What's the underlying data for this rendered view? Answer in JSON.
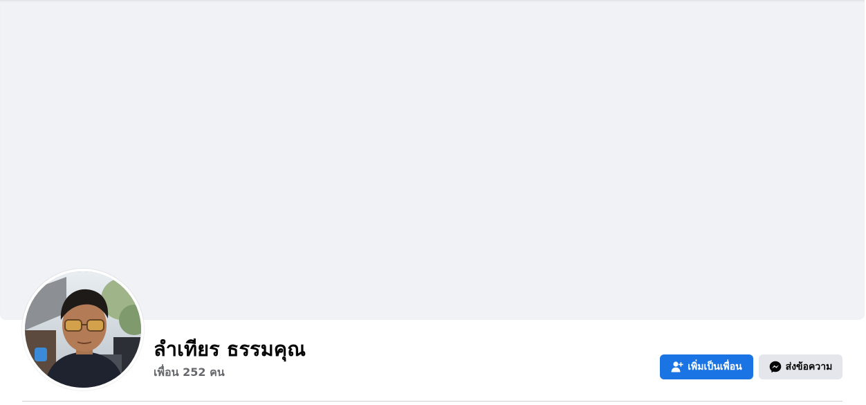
{
  "profile": {
    "name": "ลำเทียร ธรรมคุณ",
    "friends_count": "เพื่อน 252 คน"
  },
  "actions": {
    "add_friend_label": "เพิ่มเป็นเพื่อน",
    "add_friend_icon": "person-add-icon",
    "message_label": "ส่งข้อความ",
    "message_icon": "messenger-icon"
  },
  "colors": {
    "cover_background": "#f0f2f5",
    "primary_button": "#1b74e4",
    "secondary_button": "#e4e6eb",
    "name_text": "#050505",
    "secondary_text": "#65676b"
  }
}
